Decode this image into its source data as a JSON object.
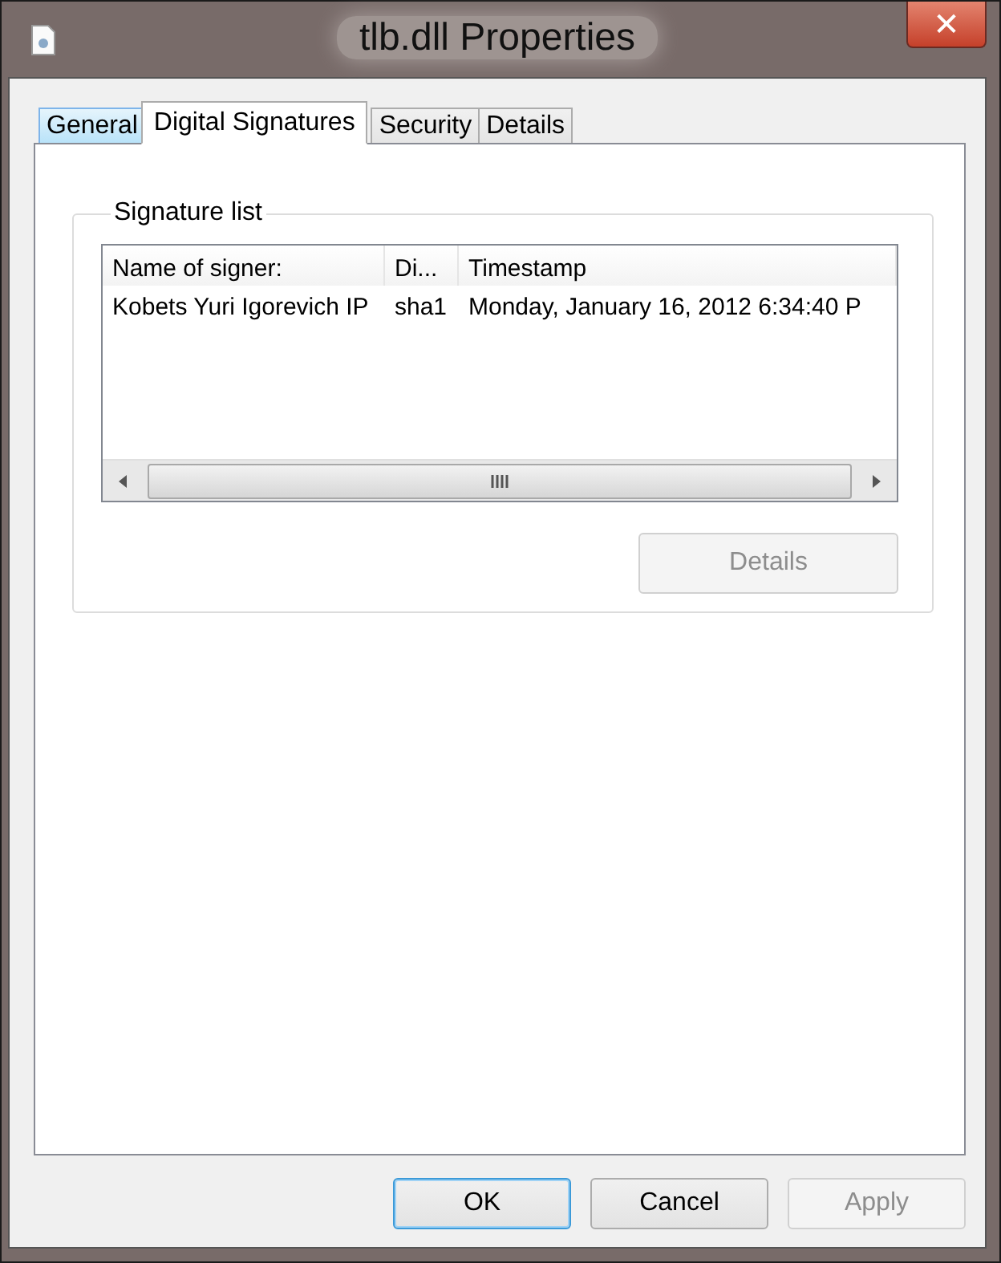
{
  "window": {
    "title": "tlb.dll Properties",
    "close_label": "✕"
  },
  "tabs": [
    {
      "label": "General",
      "selected": false,
      "hovered": true
    },
    {
      "label": "Digital Signatures",
      "selected": true,
      "hovered": false
    },
    {
      "label": "Security",
      "selected": false,
      "hovered": false
    },
    {
      "label": "Details",
      "selected": false,
      "hovered": false
    }
  ],
  "signature_list": {
    "title": "Signature list",
    "columns": [
      "Name of signer:",
      "Di...",
      "Timestamp"
    ],
    "rows": [
      [
        "Kobets Yuri Igorevich IP",
        "sha1",
        "Monday, January 16, 2012 6:34:40 P"
      ]
    ],
    "details_button": {
      "label": "Details",
      "disabled": true
    }
  },
  "buttons": [
    {
      "label": "OK",
      "default": true,
      "disabled": false
    },
    {
      "label": "Cancel",
      "default": false,
      "disabled": false
    },
    {
      "label": "Apply",
      "default": false,
      "disabled": true
    }
  ]
}
